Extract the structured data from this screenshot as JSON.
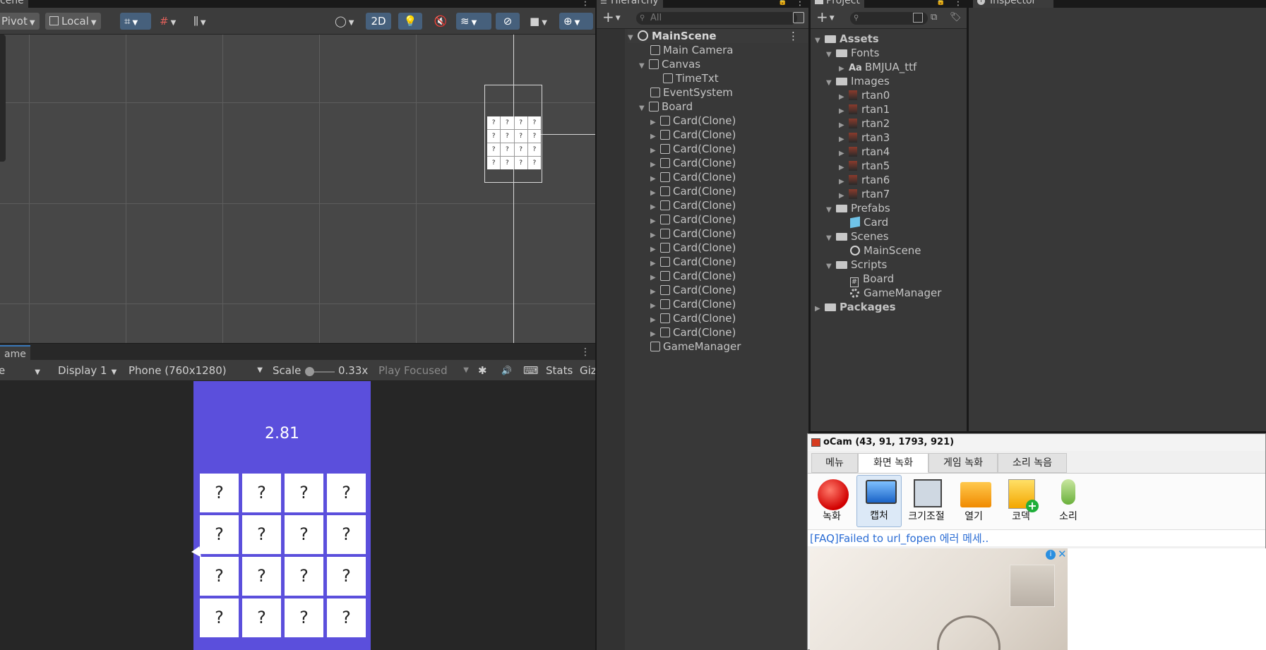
{
  "scene": {
    "tab_label": "cene",
    "toolbar": {
      "pivot_label": "Pivot",
      "local_label": "Local",
      "mode_2d_label": "2D"
    }
  },
  "game": {
    "tab_label": "ame",
    "display_label": "Display 1",
    "resolution_label": "Phone (760x1280)",
    "scale_label": "Scale",
    "scale_value": "0.33x",
    "play_focused_label": "Play Focused",
    "stats_label": "Stats",
    "gizmos_label": "Giz",
    "left_trunc": "e",
    "timer": "2.81",
    "cards": [
      "?",
      "?",
      "?",
      "?",
      "?",
      "?",
      "?",
      "?",
      "?",
      "?",
      "?",
      "?",
      "?",
      "?",
      "?",
      "?"
    ]
  },
  "hierarchy": {
    "tab_label": "Hierarchy",
    "search_placeholder": "All",
    "scene_name": "MainScene",
    "items": {
      "main_camera": "Main Camera",
      "canvas": "Canvas",
      "time_txt": "TimeTxt",
      "event_system": "EventSystem",
      "board": "Board",
      "game_manager": "GameManager"
    },
    "card_clones": [
      "Card(Clone)",
      "Card(Clone)",
      "Card(Clone)",
      "Card(Clone)",
      "Card(Clone)",
      "Card(Clone)",
      "Card(Clone)",
      "Card(Clone)",
      "Card(Clone)",
      "Card(Clone)",
      "Card(Clone)",
      "Card(Clone)",
      "Card(Clone)",
      "Card(Clone)",
      "Card(Clone)",
      "Card(Clone)"
    ]
  },
  "project": {
    "tab_label": "Project",
    "assets": "Assets",
    "fonts": "Fonts",
    "font_file": "BMJUA_ttf",
    "font_icon_text": "Aa",
    "images": "Images",
    "image_files": [
      "rtan0",
      "rtan1",
      "rtan2",
      "rtan3",
      "rtan4",
      "rtan5",
      "rtan6",
      "rtan7"
    ],
    "prefabs": "Prefabs",
    "prefab_card": "Card",
    "scenes": "Scenes",
    "scene_file": "MainScene",
    "scripts": "Scripts",
    "script_board": "Board",
    "script_gm": "GameManager",
    "script_icon_text": "#",
    "packages": "Packages"
  },
  "inspector": {
    "tab_label": "Inspector"
  },
  "ocam": {
    "title": "oCam (43, 91, 1793, 921)",
    "tabs": [
      "메뉴",
      "화면 녹화",
      "게임 녹화",
      "소리 녹음"
    ],
    "tools": [
      "녹화",
      "캡처",
      "크기조절",
      "열기",
      "코덱",
      "소리"
    ],
    "faq_text": "[FAQ]Failed to url_fopen 에러 메세..",
    "ad_close": "✕",
    "ad_info": "i"
  }
}
